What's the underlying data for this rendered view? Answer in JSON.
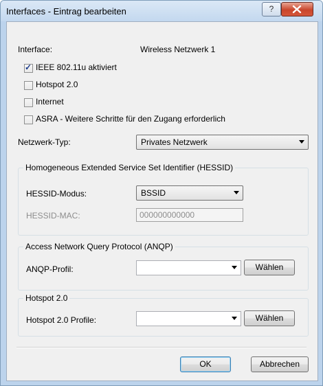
{
  "window": {
    "title": "Interfaces - Eintrag bearbeiten",
    "help_label": "?",
    "close_label": "x"
  },
  "interface": {
    "label": "Interface:",
    "value": "Wireless Netzwerk 1"
  },
  "checkboxes": [
    {
      "label": "IEEE 802.11u aktiviert",
      "checked": true
    },
    {
      "label": "Hotspot 2.0",
      "checked": false
    },
    {
      "label": "Internet",
      "checked": false
    },
    {
      "label": "ASRA - Weitere Schritte für den Zugang erforderlich",
      "checked": false
    }
  ],
  "network_type": {
    "label": "Netzwerk-Typ:",
    "value": "Privates Netzwerk"
  },
  "hessid": {
    "title": "Homogeneous Extended Service Set Identifier (HESSID)",
    "mode_label": "HESSID-Modus:",
    "mode_value": "BSSID",
    "mac_label": "HESSID-MAC:",
    "mac_value": "000000000000"
  },
  "anqp": {
    "title": "Access Network Query Protocol (ANQP)",
    "profile_label": "ANQP-Profil:",
    "profile_value": "",
    "select_button": "Wählen"
  },
  "hotspot": {
    "title": "Hotspot 2.0",
    "profile_label": "Hotspot 2.0 Profile:",
    "profile_value": "",
    "select_button": "Wählen"
  },
  "buttons": {
    "ok": "OK",
    "cancel": "Abbrechen"
  }
}
